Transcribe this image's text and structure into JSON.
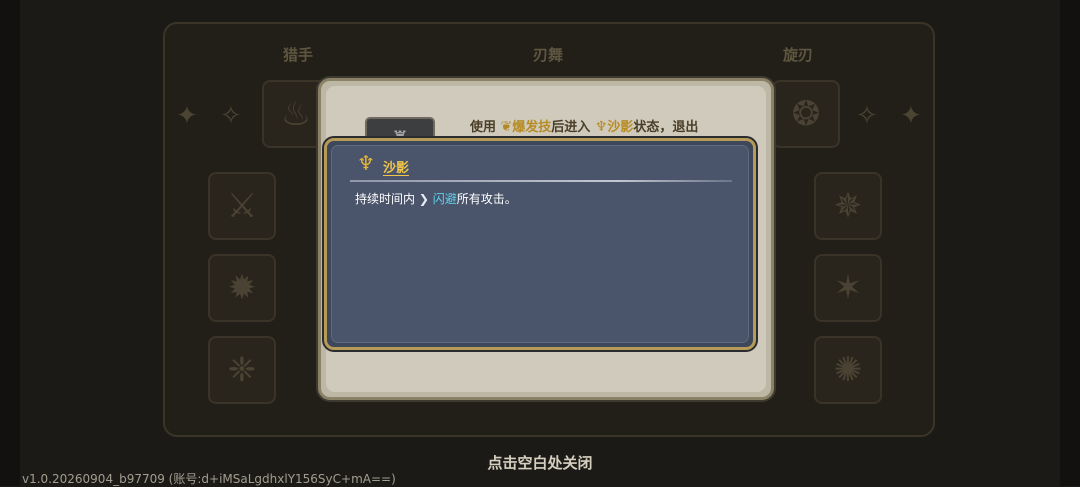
{
  "background": {
    "columns": [
      {
        "title": "猎手"
      },
      {
        "title": "刃舞"
      },
      {
        "title": "旋刃"
      }
    ]
  },
  "panel": {
    "skill_icon": "sword-tower-icon",
    "description": {
      "prefix": "使用",
      "burst_skill": "爆发技",
      "middle": "后进入",
      "state_name": "沙影",
      "suffix": "状态，退出"
    }
  },
  "tooltip": {
    "icon": "sand-shadow-crest-icon",
    "title": "沙影",
    "body_prefix": "持续时间内",
    "dodge_label": "闪避",
    "body_suffix": "所有攻击。"
  },
  "footer": {
    "close_hint": "点击空白处关闭",
    "version": "v1.0.20260904_b97709 (账号:d+iMSaLgdhxlY156SyC+mA==)"
  },
  "colors": {
    "accent_gold": "#f0c64a",
    "dodge_cyan": "#5fd2f0",
    "tooltip_bg": "#4a546a",
    "panel_bg": "#cfcabb"
  }
}
